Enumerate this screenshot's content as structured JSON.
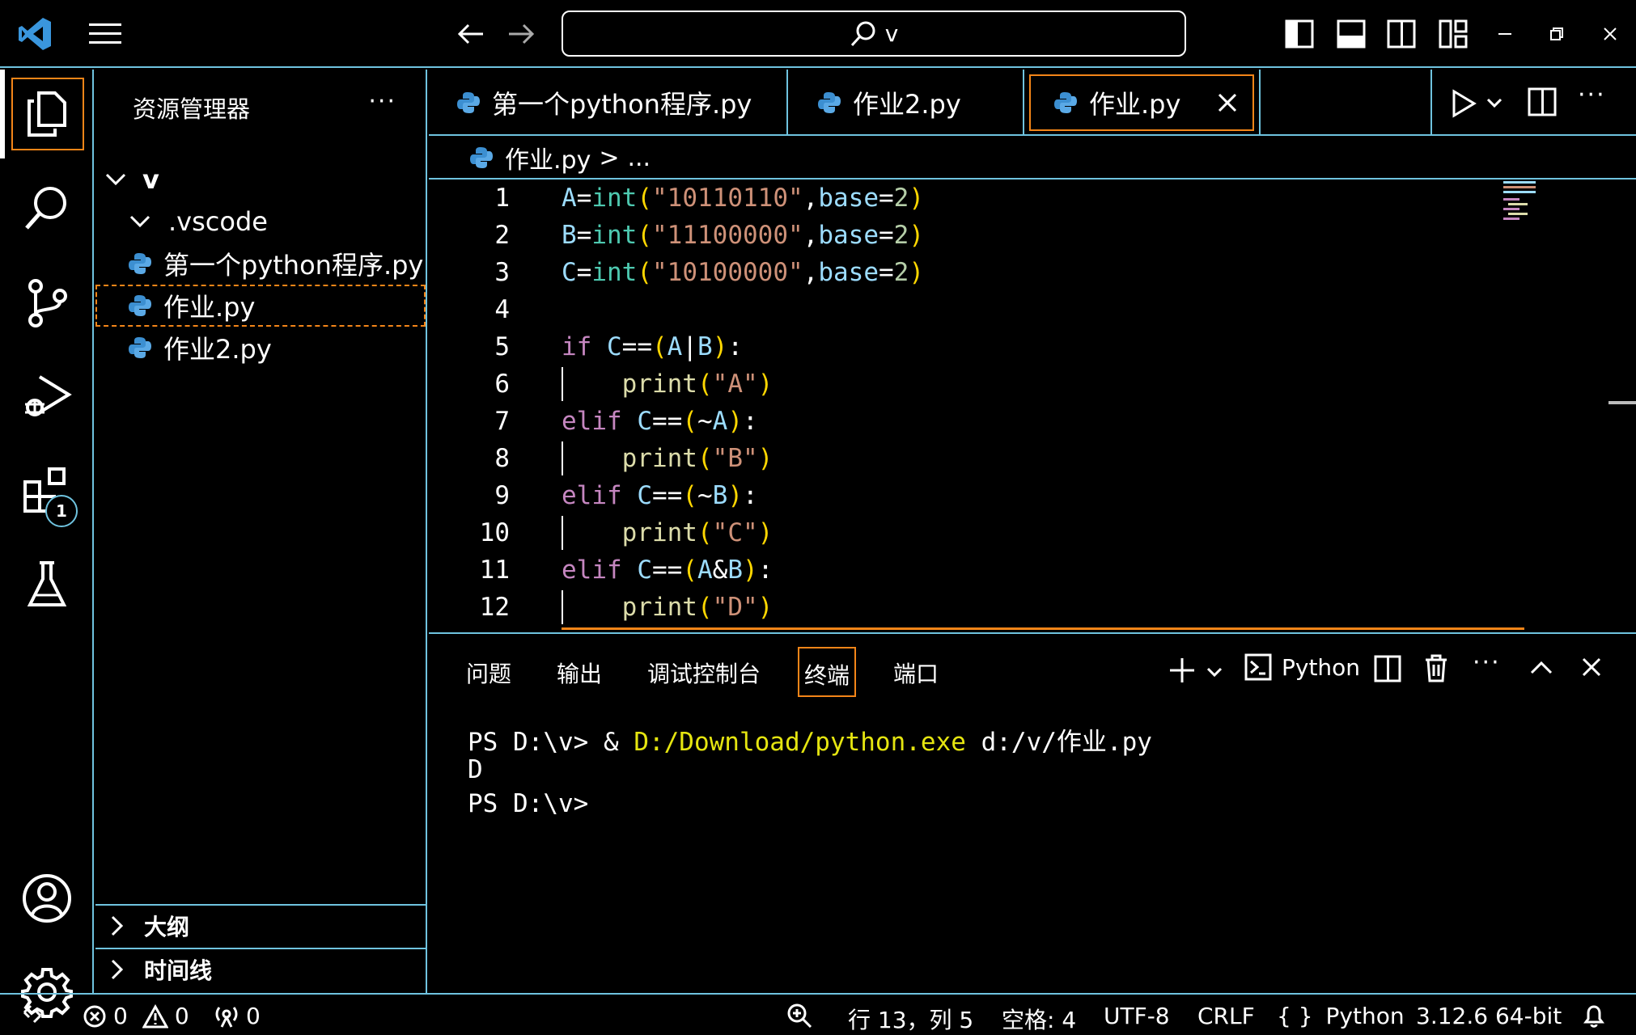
{
  "titlebar": {
    "search_text": "v"
  },
  "activitybar": {
    "extensions_badge": "1"
  },
  "sidebar": {
    "title": "资源管理器",
    "more": "···",
    "folder": "v",
    "items": [
      {
        "label": ".vscode"
      },
      {
        "label": "第一个python程序.py"
      },
      {
        "label": "作业.py"
      },
      {
        "label": "作业2.py"
      }
    ],
    "outline": "大纲",
    "timeline": "时间线"
  },
  "tabs": [
    {
      "label": "第一个python程序.py"
    },
    {
      "label": "作业2.py"
    },
    {
      "label": "作业.py"
    }
  ],
  "breadcrumb": {
    "file": "作业.py",
    "sep": ">",
    "rest": "..."
  },
  "code": {
    "line_numbers": [
      "1",
      "2",
      "3",
      "4",
      "5",
      "6",
      "7",
      "8",
      "9",
      "10",
      "11",
      "12"
    ],
    "lines": [
      {
        "t": [
          [
            "var",
            "A"
          ],
          [
            "op",
            "="
          ],
          [
            "bi",
            "int"
          ],
          [
            "par1",
            "("
          ],
          [
            "str",
            "\"10110110\""
          ],
          [
            "op",
            ","
          ],
          [
            "var",
            "base"
          ],
          [
            "op",
            "="
          ],
          [
            "num",
            "2"
          ],
          [
            "par1",
            ")"
          ]
        ]
      },
      {
        "t": [
          [
            "var",
            "B"
          ],
          [
            "op",
            "="
          ],
          [
            "bi",
            "int"
          ],
          [
            "par1",
            "("
          ],
          [
            "str",
            "\"11100000\""
          ],
          [
            "op",
            ","
          ],
          [
            "var",
            "base"
          ],
          [
            "op",
            "="
          ],
          [
            "num",
            "2"
          ],
          [
            "par1",
            ")"
          ]
        ]
      },
      {
        "t": [
          [
            "var",
            "C"
          ],
          [
            "op",
            "="
          ],
          [
            "bi",
            "int"
          ],
          [
            "par1",
            "("
          ],
          [
            "str",
            "\"10100000\""
          ],
          [
            "op",
            ","
          ],
          [
            "var",
            "base"
          ],
          [
            "op",
            "="
          ],
          [
            "num",
            "2"
          ],
          [
            "par1",
            ")"
          ]
        ]
      },
      {
        "t": []
      },
      {
        "t": [
          [
            "kw",
            "if"
          ],
          [
            "op",
            " "
          ],
          [
            "var",
            "C"
          ],
          [
            "op",
            "=="
          ],
          [
            "par1",
            "("
          ],
          [
            "var",
            "A"
          ],
          [
            "op",
            "|"
          ],
          [
            "var",
            "B"
          ],
          [
            "par1",
            ")"
          ],
          [
            "op",
            ":"
          ]
        ]
      },
      {
        "t": [
          [
            "op",
            "    "
          ],
          [
            "fn",
            "print"
          ],
          [
            "par1",
            "("
          ],
          [
            "str",
            "\"A\""
          ],
          [
            "par1",
            ")"
          ]
        ],
        "guide": true
      },
      {
        "t": [
          [
            "kw",
            "elif"
          ],
          [
            "op",
            " "
          ],
          [
            "var",
            "C"
          ],
          [
            "op",
            "=="
          ],
          [
            "par1",
            "("
          ],
          [
            "op",
            "~"
          ],
          [
            "var",
            "A"
          ],
          [
            "par1",
            ")"
          ],
          [
            "op",
            ":"
          ]
        ]
      },
      {
        "t": [
          [
            "op",
            "    "
          ],
          [
            "fn",
            "print"
          ],
          [
            "par1",
            "("
          ],
          [
            "str",
            "\"B\""
          ],
          [
            "par1",
            ")"
          ]
        ],
        "guide": true
      },
      {
        "t": [
          [
            "kw",
            "elif"
          ],
          [
            "op",
            " "
          ],
          [
            "var",
            "C"
          ],
          [
            "op",
            "=="
          ],
          [
            "par1",
            "("
          ],
          [
            "op",
            "~"
          ],
          [
            "var",
            "B"
          ],
          [
            "par1",
            ")"
          ],
          [
            "op",
            ":"
          ]
        ]
      },
      {
        "t": [
          [
            "op",
            "    "
          ],
          [
            "fn",
            "print"
          ],
          [
            "par1",
            "("
          ],
          [
            "str",
            "\"C\""
          ],
          [
            "par1",
            ")"
          ]
        ],
        "guide": true
      },
      {
        "t": [
          [
            "kw",
            "elif"
          ],
          [
            "op",
            " "
          ],
          [
            "var",
            "C"
          ],
          [
            "op",
            "=="
          ],
          [
            "par1",
            "("
          ],
          [
            "var",
            "A"
          ],
          [
            "op",
            "&"
          ],
          [
            "var",
            "B"
          ],
          [
            "par1",
            ")"
          ],
          [
            "op",
            ":"
          ]
        ]
      },
      {
        "t": [
          [
            "op",
            "    "
          ],
          [
            "fn",
            "print"
          ],
          [
            "par1",
            "("
          ],
          [
            "str",
            "\"D\""
          ],
          [
            "par1",
            ")"
          ]
        ],
        "guide": true
      }
    ]
  },
  "panel": {
    "tabs": [
      "问题",
      "输出",
      "调试控制台",
      "终端",
      "端口"
    ],
    "shell_label": "Python",
    "terminal": {
      "line1_prompt": "PS D:\\v> & ",
      "line1_exe": "D:/Download/python.exe",
      "line1_arg": " d:/v/作业.py",
      "line2": "D",
      "line3": "PS D:\\v>"
    }
  },
  "statusbar": {
    "errors": "0",
    "warnings": "0",
    "ports": "0",
    "position": "行 13，列 5",
    "spaces": "空格: 4",
    "encoding": "UTF-8",
    "eol": "CRLF",
    "language": "Python",
    "interpreter": "3.12.6 64-bit"
  },
  "colors": {
    "border": "#6fc3df",
    "focus": "#f38518",
    "keyword": "#c586c0",
    "function": "#dcdcaa",
    "builtin": "#4ec9b0",
    "string": "#ce9178",
    "variable": "#9cdcfe",
    "number": "#b5cea8",
    "exe": "#e5e510"
  }
}
